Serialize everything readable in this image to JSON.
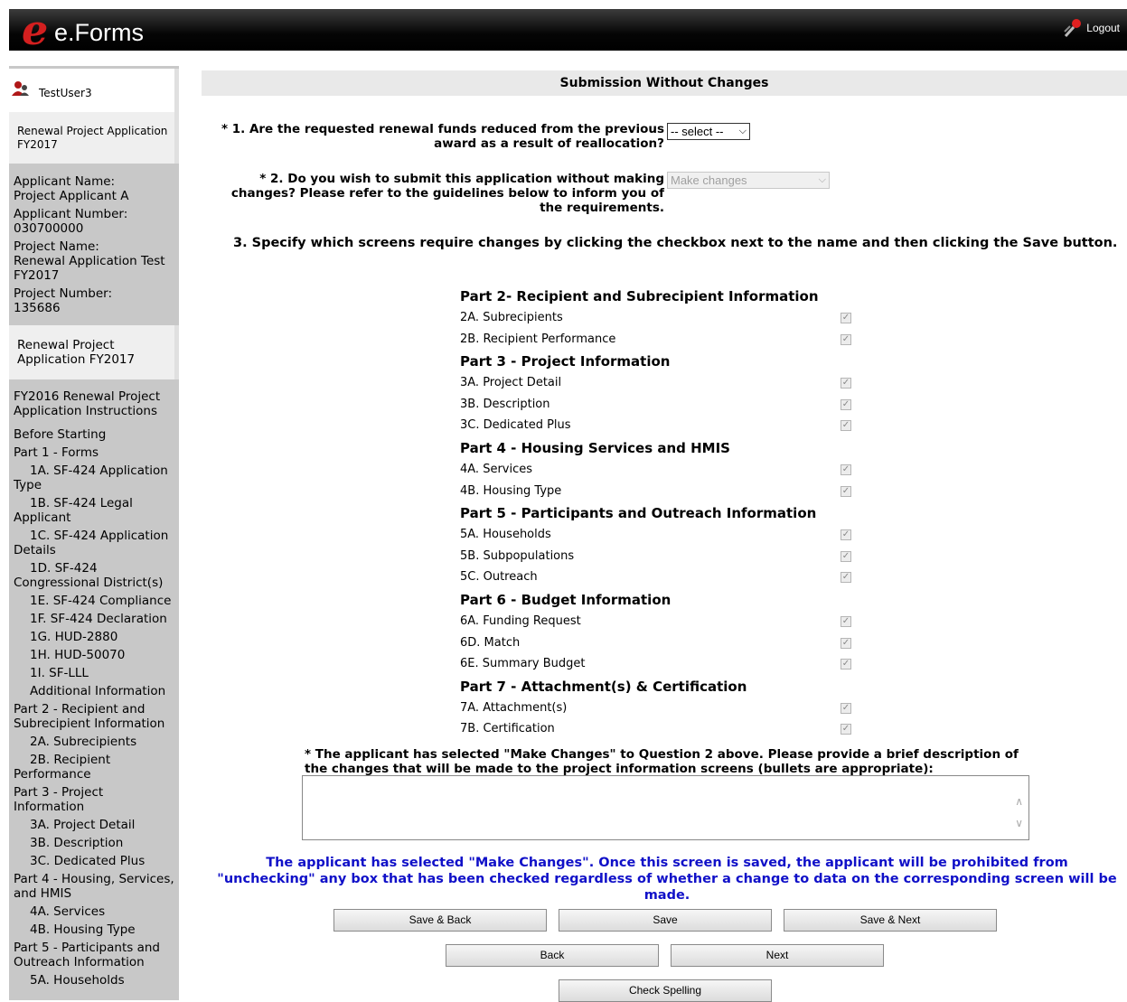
{
  "header": {
    "logo_letter": "e",
    "app_name": "e.Forms",
    "logout_label": "Logout"
  },
  "sidebar": {
    "user": "TestUser3",
    "tab1": "Renewal Project Application FY2017",
    "applicant_name_label": "Applicant Name:",
    "applicant_name": "Project Applicant A",
    "applicant_number_label": "Applicant Number:",
    "applicant_number": "030700000",
    "project_name_label": "Project Name:",
    "project_name": "Renewal Application Test FY2017",
    "project_number_label": "Project Number:",
    "project_number": "135686",
    "tab2": "Renewal Project Application FY2017",
    "nav": [
      {
        "label": "FY2016 Renewal Project Application Instructions",
        "sub": false
      },
      {
        "label": "",
        "sub": false
      },
      {
        "label": "Before Starting",
        "sub": false
      },
      {
        "label": "Part 1 - Forms",
        "sub": false
      },
      {
        "label": "1A. SF-424 Application Type",
        "sub": true
      },
      {
        "label": "1B. SF-424 Legal Applicant",
        "sub": true
      },
      {
        "label": "1C. SF-424 Application Details",
        "sub": true
      },
      {
        "label": "1D. SF-424 Congressional District(s)",
        "sub": true
      },
      {
        "label": "1E. SF-424 Compliance",
        "sub": true
      },
      {
        "label": "1F. SF-424 Declaration",
        "sub": true
      },
      {
        "label": "1G. HUD-2880",
        "sub": true
      },
      {
        "label": "1H. HUD-50070",
        "sub": true
      },
      {
        "label": "1I. SF-LLL",
        "sub": true
      },
      {
        "label": "Additional Information",
        "sub": true
      },
      {
        "label": "Part 2 - Recipient and Subrecipient Information",
        "sub": false
      },
      {
        "label": "2A. Subrecipients",
        "sub": true
      },
      {
        "label": "2B. Recipient Performance",
        "sub": true
      },
      {
        "label": "Part 3 - Project Information",
        "sub": false
      },
      {
        "label": "3A. Project Detail",
        "sub": true
      },
      {
        "label": "3B. Description",
        "sub": true
      },
      {
        "label": "3C. Dedicated Plus",
        "sub": true
      },
      {
        "label": "Part 4 - Housing, Services, and HMIS",
        "sub": false
      },
      {
        "label": "4A. Services",
        "sub": true
      },
      {
        "label": "4B. Housing Type",
        "sub": true
      },
      {
        "label": "Part 5 - Participants and Outreach Information",
        "sub": false
      },
      {
        "label": "5A. Households",
        "sub": true
      }
    ]
  },
  "main": {
    "title": "Submission Without Changes",
    "q1_label": "* 1. Are the requested renewal funds reduced from the previous award as a result of reallocation?",
    "q1_value": "-- select --",
    "q2_label": "* 2. Do you wish to submit this application without making changes? Please refer to the guidelines below to inform you of the requirements.",
    "q2_value": "Make changes",
    "q3_label": "3. Specify which screens require changes by clicking the checkbox next to the name and then clicking the Save button.",
    "parts": [
      {
        "title": "Part 2- Recipient and Subrecipient Information",
        "items": [
          "2A. Subrecipients",
          "2B. Recipient Performance"
        ]
      },
      {
        "title": "Part 3 - Project Information",
        "items": [
          "3A. Project Detail",
          "3B. Description",
          "3C. Dedicated Plus"
        ]
      },
      {
        "title": "Part 4 - Housing Services and HMIS",
        "items": [
          "4A. Services",
          "4B. Housing Type"
        ]
      },
      {
        "title": "Part 5 - Participants and Outreach Information",
        "items": [
          "5A. Households",
          "5B. Subpopulations",
          "5C. Outreach"
        ]
      },
      {
        "title": "Part 6 - Budget Information",
        "items": [
          "6A. Funding Request",
          "6D. Match",
          "6E. Summary Budget"
        ]
      },
      {
        "title": "Part 7 - Attachment(s) & Certification",
        "items": [
          "7A. Attachment(s)",
          "7B. Certification"
        ]
      }
    ],
    "checkbox_checked": true,
    "changes_prompt": "* The applicant has selected \"Make Changes\" to Question 2 above. Please provide a brief description of the changes that will be made to the project information screens (bullets are appropriate):",
    "changes_value": "",
    "warning": "The applicant has selected \"Make Changes\". Once this screen is saved, the applicant will be prohibited from \"unchecking\" any box that has been checked regardless of whether a change to data on the corresponding screen will be made."
  },
  "buttons": {
    "save_back": "Save & Back",
    "save": "Save",
    "save_next": "Save & Next",
    "back": "Back",
    "next": "Next",
    "check_spelling": "Check Spelling"
  }
}
